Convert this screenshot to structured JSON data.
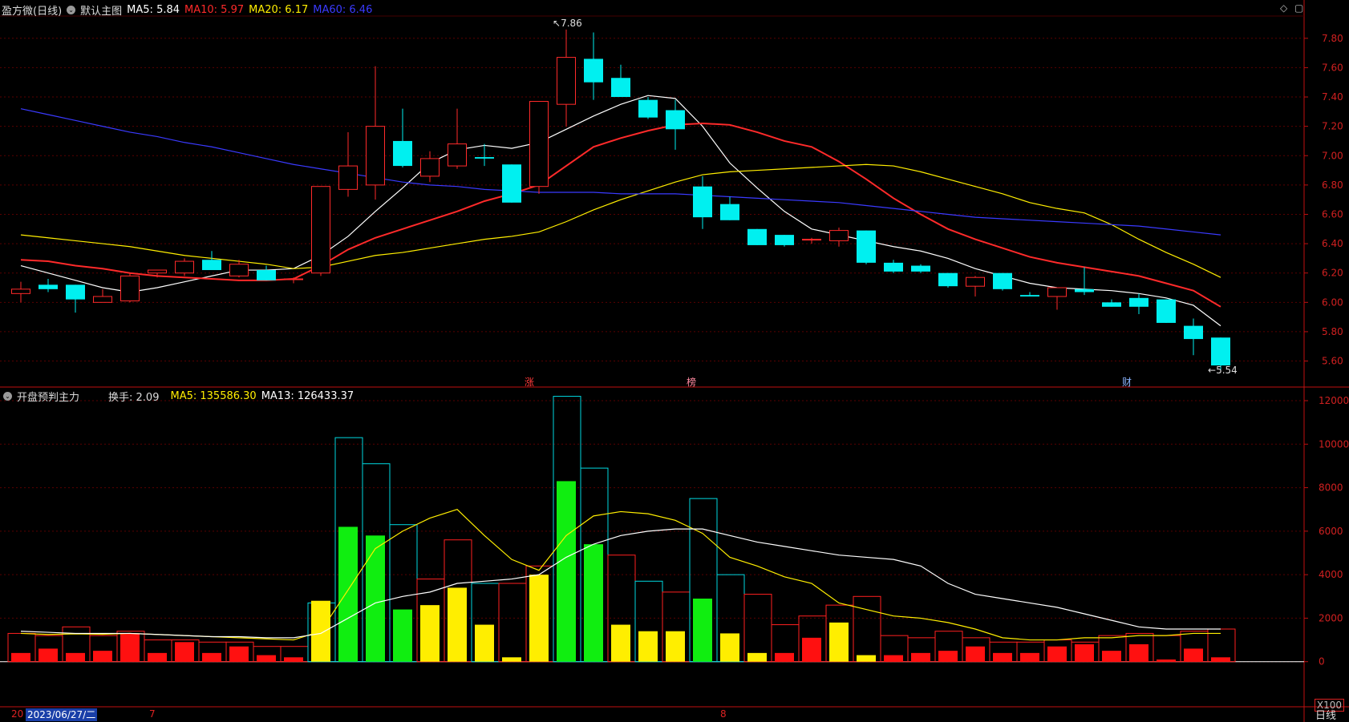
{
  "app": {
    "title": "盈方微(日线)",
    "template_label": "默认主图",
    "ma": [
      {
        "label": "MA5: 5.84",
        "color": "#ffffff"
      },
      {
        "label": "MA10: 5.97",
        "color": "#ff2a2a"
      },
      {
        "label": "MA20: 6.17",
        "color": "#ffee00"
      },
      {
        "label": "MA60: 6.46",
        "color": "#3a3aff"
      }
    ]
  },
  "indicator": {
    "title": "开盘预判主力",
    "turnover": "换手: 2.09",
    "ma5": "MA5: 135586.30",
    "ma13": "MA13: 126433.37"
  },
  "markers": {
    "high": "7.86",
    "low": "5.54",
    "tag1": "涨",
    "tag2": "榜",
    "tag3": "财"
  },
  "xaxis": {
    "left_label": "20",
    "date_box": "2023/06/27/二",
    "tick_jul": "7",
    "tick_aug": "8"
  },
  "ui": {
    "scale_button": "X100",
    "period": "日线"
  },
  "chart_data": [
    {
      "type": "candlestick",
      "title": "盈方微(日线)",
      "ylim": [
        5.45,
        7.93
      ],
      "yticks": [
        "7.80",
        "7.60",
        "7.40",
        "7.20",
        "7.00",
        "6.80",
        "6.60",
        "6.40",
        "6.20",
        "6.00",
        "5.80",
        "5.60"
      ],
      "ohlc": [
        [
          6.06,
          6.14,
          6.0,
          6.09
        ],
        [
          6.12,
          6.16,
          6.07,
          6.09
        ],
        [
          6.12,
          6.12,
          5.93,
          6.02
        ],
        [
          6.0,
          6.09,
          6.0,
          6.04
        ],
        [
          6.01,
          6.2,
          6.0,
          6.18
        ],
        [
          6.2,
          6.22,
          6.17,
          6.22
        ],
        [
          6.2,
          6.3,
          6.18,
          6.28
        ],
        [
          6.29,
          6.35,
          6.22,
          6.22
        ],
        [
          6.18,
          6.29,
          6.17,
          6.26
        ],
        [
          6.22,
          6.25,
          6.15,
          6.15
        ],
        [
          6.16,
          6.17,
          6.13,
          6.16
        ],
        [
          6.2,
          6.79,
          6.18,
          6.79
        ],
        [
          6.77,
          7.16,
          6.72,
          6.93
        ],
        [
          6.8,
          7.61,
          6.7,
          7.2
        ],
        [
          7.1,
          7.32,
          6.92,
          6.93
        ],
        [
          6.86,
          7.03,
          6.82,
          6.98
        ],
        [
          6.93,
          7.32,
          6.91,
          7.08
        ],
        [
          6.99,
          7.08,
          6.93,
          6.98
        ],
        [
          6.94,
          6.94,
          6.68,
          6.68
        ],
        [
          6.79,
          7.37,
          6.74,
          7.37
        ],
        [
          7.35,
          7.86,
          7.2,
          7.67
        ],
        [
          7.66,
          7.84,
          7.38,
          7.5
        ],
        [
          7.53,
          7.62,
          7.4,
          7.4
        ],
        [
          7.38,
          7.4,
          7.25,
          7.26
        ],
        [
          7.31,
          7.38,
          7.04,
          7.18
        ],
        [
          6.79,
          6.86,
          6.5,
          6.58
        ],
        [
          6.67,
          6.72,
          6.56,
          6.56
        ],
        [
          6.5,
          6.5,
          6.39,
          6.39
        ],
        [
          6.46,
          6.46,
          6.38,
          6.39
        ],
        [
          6.43,
          6.44,
          6.4,
          6.43
        ],
        [
          6.42,
          6.51,
          6.38,
          6.49
        ],
        [
          6.49,
          6.49,
          6.26,
          6.27
        ],
        [
          6.27,
          6.29,
          6.2,
          6.21
        ],
        [
          6.25,
          6.26,
          6.2,
          6.21
        ],
        [
          6.2,
          6.2,
          6.1,
          6.11
        ],
        [
          6.11,
          6.18,
          6.04,
          6.17
        ],
        [
          6.2,
          6.2,
          6.08,
          6.09
        ],
        [
          6.05,
          6.07,
          6.04,
          6.04
        ],
        [
          6.04,
          6.1,
          5.95,
          6.1
        ],
        [
          6.09,
          6.24,
          6.05,
          6.07
        ],
        [
          6.0,
          6.02,
          5.97,
          5.97
        ],
        [
          6.03,
          6.06,
          5.92,
          5.97
        ],
        [
          6.02,
          6.02,
          5.86,
          5.86
        ],
        [
          5.84,
          5.89,
          5.64,
          5.75
        ],
        [
          5.76,
          5.76,
          5.54,
          5.57
        ]
      ],
      "ma_series": [
        {
          "name": "MA5",
          "color": "#ffffff",
          "values": [
            6.25,
            6.2,
            6.15,
            6.1,
            6.07,
            6.1,
            6.14,
            6.18,
            6.22,
            6.22,
            6.23,
            6.32,
            6.45,
            6.62,
            6.78,
            6.95,
            7.04,
            7.07,
            7.05,
            7.09,
            7.18,
            7.27,
            7.35,
            7.41,
            7.39,
            7.2,
            6.95,
            6.78,
            6.62,
            6.5,
            6.46,
            6.42,
            6.38,
            6.35,
            6.3,
            6.23,
            6.18,
            6.13,
            6.1,
            6.09,
            6.08,
            6.06,
            6.03,
            5.98,
            5.84
          ]
        },
        {
          "name": "MA10",
          "color": "#ff2a2a",
          "values": [
            6.29,
            6.28,
            6.25,
            6.23,
            6.2,
            6.18,
            6.17,
            6.16,
            6.15,
            6.15,
            6.16,
            6.25,
            6.36,
            6.44,
            6.5,
            6.56,
            6.62,
            6.69,
            6.74,
            6.8,
            6.93,
            7.06,
            7.12,
            7.17,
            7.21,
            7.22,
            7.21,
            7.16,
            7.1,
            7.06,
            6.96,
            6.84,
            6.71,
            6.6,
            6.5,
            6.43,
            6.37,
            6.31,
            6.27,
            6.24,
            6.21,
            6.18,
            6.13,
            6.08,
            5.97
          ]
        },
        {
          "name": "MA20",
          "color": "#ffee00",
          "values": [
            6.46,
            6.44,
            6.42,
            6.4,
            6.38,
            6.35,
            6.32,
            6.3,
            6.28,
            6.26,
            6.23,
            6.24,
            6.28,
            6.32,
            6.34,
            6.37,
            6.4,
            6.43,
            6.45,
            6.48,
            6.55,
            6.63,
            6.7,
            6.76,
            6.82,
            6.87,
            6.89,
            6.9,
            6.91,
            6.92,
            6.93,
            6.94,
            6.93,
            6.89,
            6.84,
            6.79,
            6.74,
            6.68,
            6.64,
            6.61,
            6.53,
            6.43,
            6.34,
            6.26,
            6.17
          ]
        },
        {
          "name": "MA60",
          "color": "#3a3aff",
          "values": [
            7.32,
            7.28,
            7.24,
            7.2,
            7.16,
            7.13,
            7.09,
            7.06,
            7.02,
            6.98,
            6.94,
            6.91,
            6.88,
            6.85,
            6.82,
            6.8,
            6.79,
            6.77,
            6.76,
            6.75,
            6.75,
            6.75,
            6.74,
            6.74,
            6.74,
            6.73,
            6.72,
            6.71,
            6.7,
            6.69,
            6.68,
            6.66,
            6.64,
            6.62,
            6.6,
            6.58,
            6.57,
            6.56,
            6.55,
            6.54,
            6.53,
            6.52,
            6.5,
            6.48,
            6.46
          ]
        }
      ]
    },
    {
      "type": "bar",
      "title": "开盘预判主力",
      "ylim": [
        -2000,
        12000
      ],
      "yticks": [
        "12000",
        "10000",
        "8000",
        "6000",
        "4000",
        "2000",
        "0"
      ],
      "outline": [
        1300,
        1200,
        1600,
        1200,
        1400,
        1000,
        1000,
        900,
        900,
        700,
        700,
        2700,
        10300,
        9100,
        6300,
        3800,
        5600,
        3600,
        3600,
        4400,
        12200,
        8900,
        4900,
        3700,
        3200,
        7500,
        4000,
        3100,
        1700,
        2100,
        2600,
        3000,
        1200,
        1100,
        1400,
        1100,
        900,
        900,
        1000,
        900,
        1200,
        1300,
        1200,
        1400,
        1500
      ],
      "filled": [
        [
          400,
          "#ff1010"
        ],
        [
          600,
          "#ff1010"
        ],
        [
          400,
          "#ff1010"
        ],
        [
          500,
          "#ff1010"
        ],
        [
          1300,
          "#ff1010"
        ],
        [
          400,
          "#ff1010"
        ],
        [
          900,
          "#ff1010"
        ],
        [
          400,
          "#ff1010"
        ],
        [
          700,
          "#ff1010"
        ],
        [
          300,
          "#ff1010"
        ],
        [
          200,
          "#ff1010"
        ],
        [
          2800,
          "#ffee00"
        ],
        [
          6200,
          "#10ee10"
        ],
        [
          5800,
          "#10ee10"
        ],
        [
          2400,
          "#10ee10"
        ],
        [
          2600,
          "#ffee00"
        ],
        [
          3400,
          "#ffee00"
        ],
        [
          1700,
          "#ffee00"
        ],
        [
          200,
          "#ffee00"
        ],
        [
          4000,
          "#ffee00"
        ],
        [
          8300,
          "#10ee10"
        ],
        [
          5400,
          "#10ee10"
        ],
        [
          1700,
          "#ffee00"
        ],
        [
          1400,
          "#ffee00"
        ],
        [
          1400,
          "#ffee00"
        ],
        [
          2900,
          "#10ee10"
        ],
        [
          1300,
          "#ffee00"
        ],
        [
          400,
          "#ffee00"
        ],
        [
          400,
          "#ff1010"
        ],
        [
          1100,
          "#ff1010"
        ],
        [
          1800,
          "#ffee00"
        ],
        [
          300,
          "#ffee00"
        ],
        [
          300,
          "#ff1010"
        ],
        [
          400,
          "#ff1010"
        ],
        [
          500,
          "#ff1010"
        ],
        [
          700,
          "#ff1010"
        ],
        [
          400,
          "#ff1010"
        ],
        [
          400,
          "#ff1010"
        ],
        [
          700,
          "#ff1010"
        ],
        [
          800,
          "#ff1010"
        ],
        [
          500,
          "#ff1010"
        ],
        [
          800,
          "#ff1010"
        ],
        [
          100,
          "#ff1010"
        ],
        [
          600,
          "#ff1010"
        ],
        [
          200,
          "#ff1010"
        ]
      ],
      "line_series": [
        {
          "name": "MA5",
          "color": "#ffee00",
          "values": [
            1300,
            1250,
            1280,
            1260,
            1300,
            1250,
            1200,
            1150,
            1100,
            1050,
            1000,
            1400,
            3300,
            5200,
            6000,
            6600,
            7000,
            5800,
            4700,
            4200,
            5800,
            6700,
            6900,
            6800,
            6500,
            5900,
            4800,
            4400,
            3900,
            3600,
            2700,
            2400,
            2100,
            2000,
            1800,
            1500,
            1100,
            1000,
            1000,
            1100,
            1100,
            1200,
            1200,
            1300,
            1300
          ]
        },
        {
          "name": "MA13",
          "color": "#ffffff",
          "values": [
            1400,
            1350,
            1300,
            1300,
            1300,
            1250,
            1200,
            1150,
            1150,
            1100,
            1100,
            1300,
            2000,
            2700,
            3000,
            3200,
            3600,
            3700,
            3800,
            4000,
            4800,
            5400,
            5800,
            6000,
            6100,
            6100,
            5800,
            5500,
            5300,
            5100,
            4900,
            4800,
            4700,
            4400,
            3600,
            3100,
            2900,
            2700,
            2500,
            2200,
            1900,
            1600,
            1500,
            1500,
            1500
          ]
        }
      ]
    }
  ]
}
